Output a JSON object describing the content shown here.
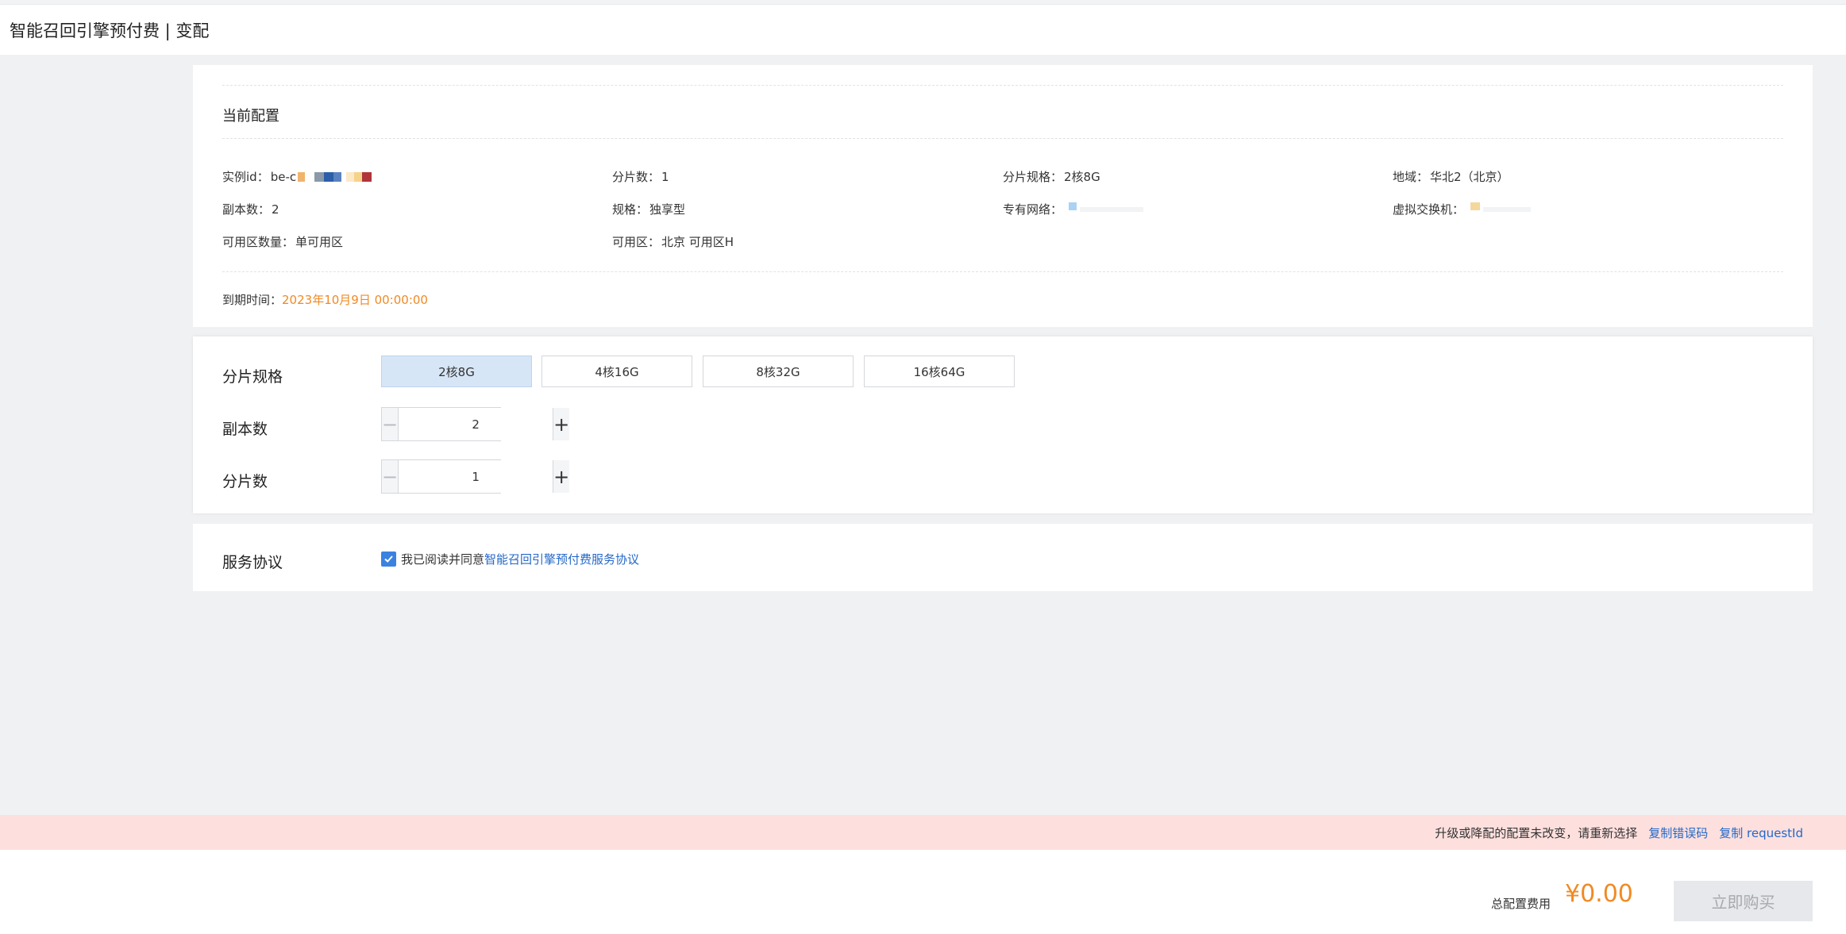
{
  "header": {
    "title": "智能召回引擎预付费 | 变配"
  },
  "current": {
    "section_title": "当前配置",
    "instance_id_label": "实例id：",
    "instance_id_value": "be-c",
    "shard_count_label": "分片数：",
    "shard_count_value": "1",
    "shard_spec_label": "分片规格：",
    "shard_spec_value": "2核8G",
    "region_label": "地域：",
    "region_value": "华北2（北京）",
    "replica_label": "副本数：",
    "replica_value": "2",
    "spec_label": "规格：",
    "spec_value": "独享型",
    "vpc_label": "专有网络：",
    "vswitch_label": "虚拟交换机：",
    "zone_count_label": "可用区数量：",
    "zone_count_value": "单可用区",
    "zone_label": "可用区：",
    "zone_value": "北京 可用区H",
    "expire_label": "到期时间：",
    "expire_value": "2023年10月9日 00:00:00"
  },
  "config": {
    "shard_spec_label": "分片规格",
    "spec_options": [
      "2核8G",
      "4核16G",
      "8核32G",
      "16核64G"
    ],
    "selected_spec": "2核8G",
    "replica_label": "副本数",
    "replica_value": "2",
    "shard_count_label": "分片数",
    "shard_count_value": "1"
  },
  "agreement": {
    "label": "服务协议",
    "text": "我已阅读并同意",
    "link": "智能召回引擎预付费服务协议",
    "checked": true
  },
  "alert": {
    "message": "升级或降配的配置未改变，请重新选择",
    "copy_error": "复制错误码",
    "copy_request": "复制 requestId"
  },
  "footer": {
    "fee_label": "总配置费用",
    "fee_value": "¥0.00",
    "buy_label": "立即购买"
  },
  "colors": {
    "accent": "#2468c8",
    "price": "#f08a24",
    "alert_bg": "#fde0de",
    "selected_bg": "#d7e6f7"
  }
}
